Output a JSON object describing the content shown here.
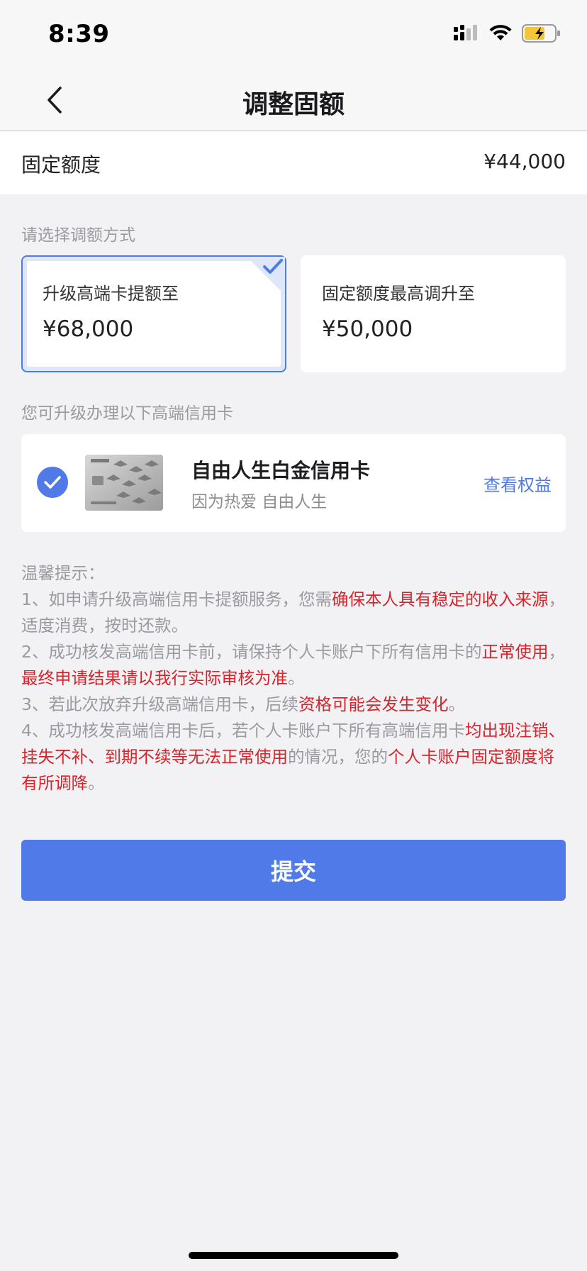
{
  "status_bar": {
    "time": "8:39"
  },
  "nav": {
    "title": "调整固额"
  },
  "fixed_limit": {
    "label": "固定额度",
    "value": "¥44,000"
  },
  "select_method": {
    "label": "请选择调额方式",
    "options": [
      {
        "title": "升级高端卡提额至",
        "amount": "¥68,000",
        "selected": true
      },
      {
        "title": "固定额度最高调升至",
        "amount": "¥50,000",
        "selected": false
      }
    ]
  },
  "upgrade_section": {
    "label": "您可升级办理以下高端信用卡",
    "card": {
      "name": "自由人生白金信用卡",
      "slogan": "因为热爱 自由人生",
      "link": "查看权益",
      "checked": true
    }
  },
  "tips": {
    "title": "温馨提示：",
    "items": [
      [
        {
          "t": "1、如申请升级高端信用卡提额服务，您需",
          "hl": false
        },
        {
          "t": "确保本人具有稳定的收入来源",
          "hl": true
        },
        {
          "t": "，适度消费，按时还款。",
          "hl": false
        }
      ],
      [
        {
          "t": "2、成功核发高端信用卡前，请保持个人卡账户下所有信用卡的",
          "hl": false
        },
        {
          "t": "正常使用",
          "hl": true
        },
        {
          "t": "，",
          "hl": false
        },
        {
          "t": "最终申请结果请以我行实际审核为准",
          "hl": true
        },
        {
          "t": "。",
          "hl": false
        }
      ],
      [
        {
          "t": "3、若此次放弃升级高端信用卡，后续",
          "hl": false
        },
        {
          "t": "资格可能会发生变化",
          "hl": true
        },
        {
          "t": "。",
          "hl": false
        }
      ],
      [
        {
          "t": "4、成功核发高端信用卡后，若个人卡账户下所有高端信用卡",
          "hl": false
        },
        {
          "t": "均出现注销、挂失不补、到期不续等无法正常使用",
          "hl": true
        },
        {
          "t": "的情况，您的",
          "hl": false
        },
        {
          "t": "个人卡账户固定额度将有所调降",
          "hl": true
        },
        {
          "t": "。",
          "hl": false
        }
      ]
    ]
  },
  "submit": {
    "label": "提交"
  },
  "colors": {
    "accent": "#4f7ae8",
    "warning": "#d6262c",
    "background": "#f2f2f5"
  }
}
